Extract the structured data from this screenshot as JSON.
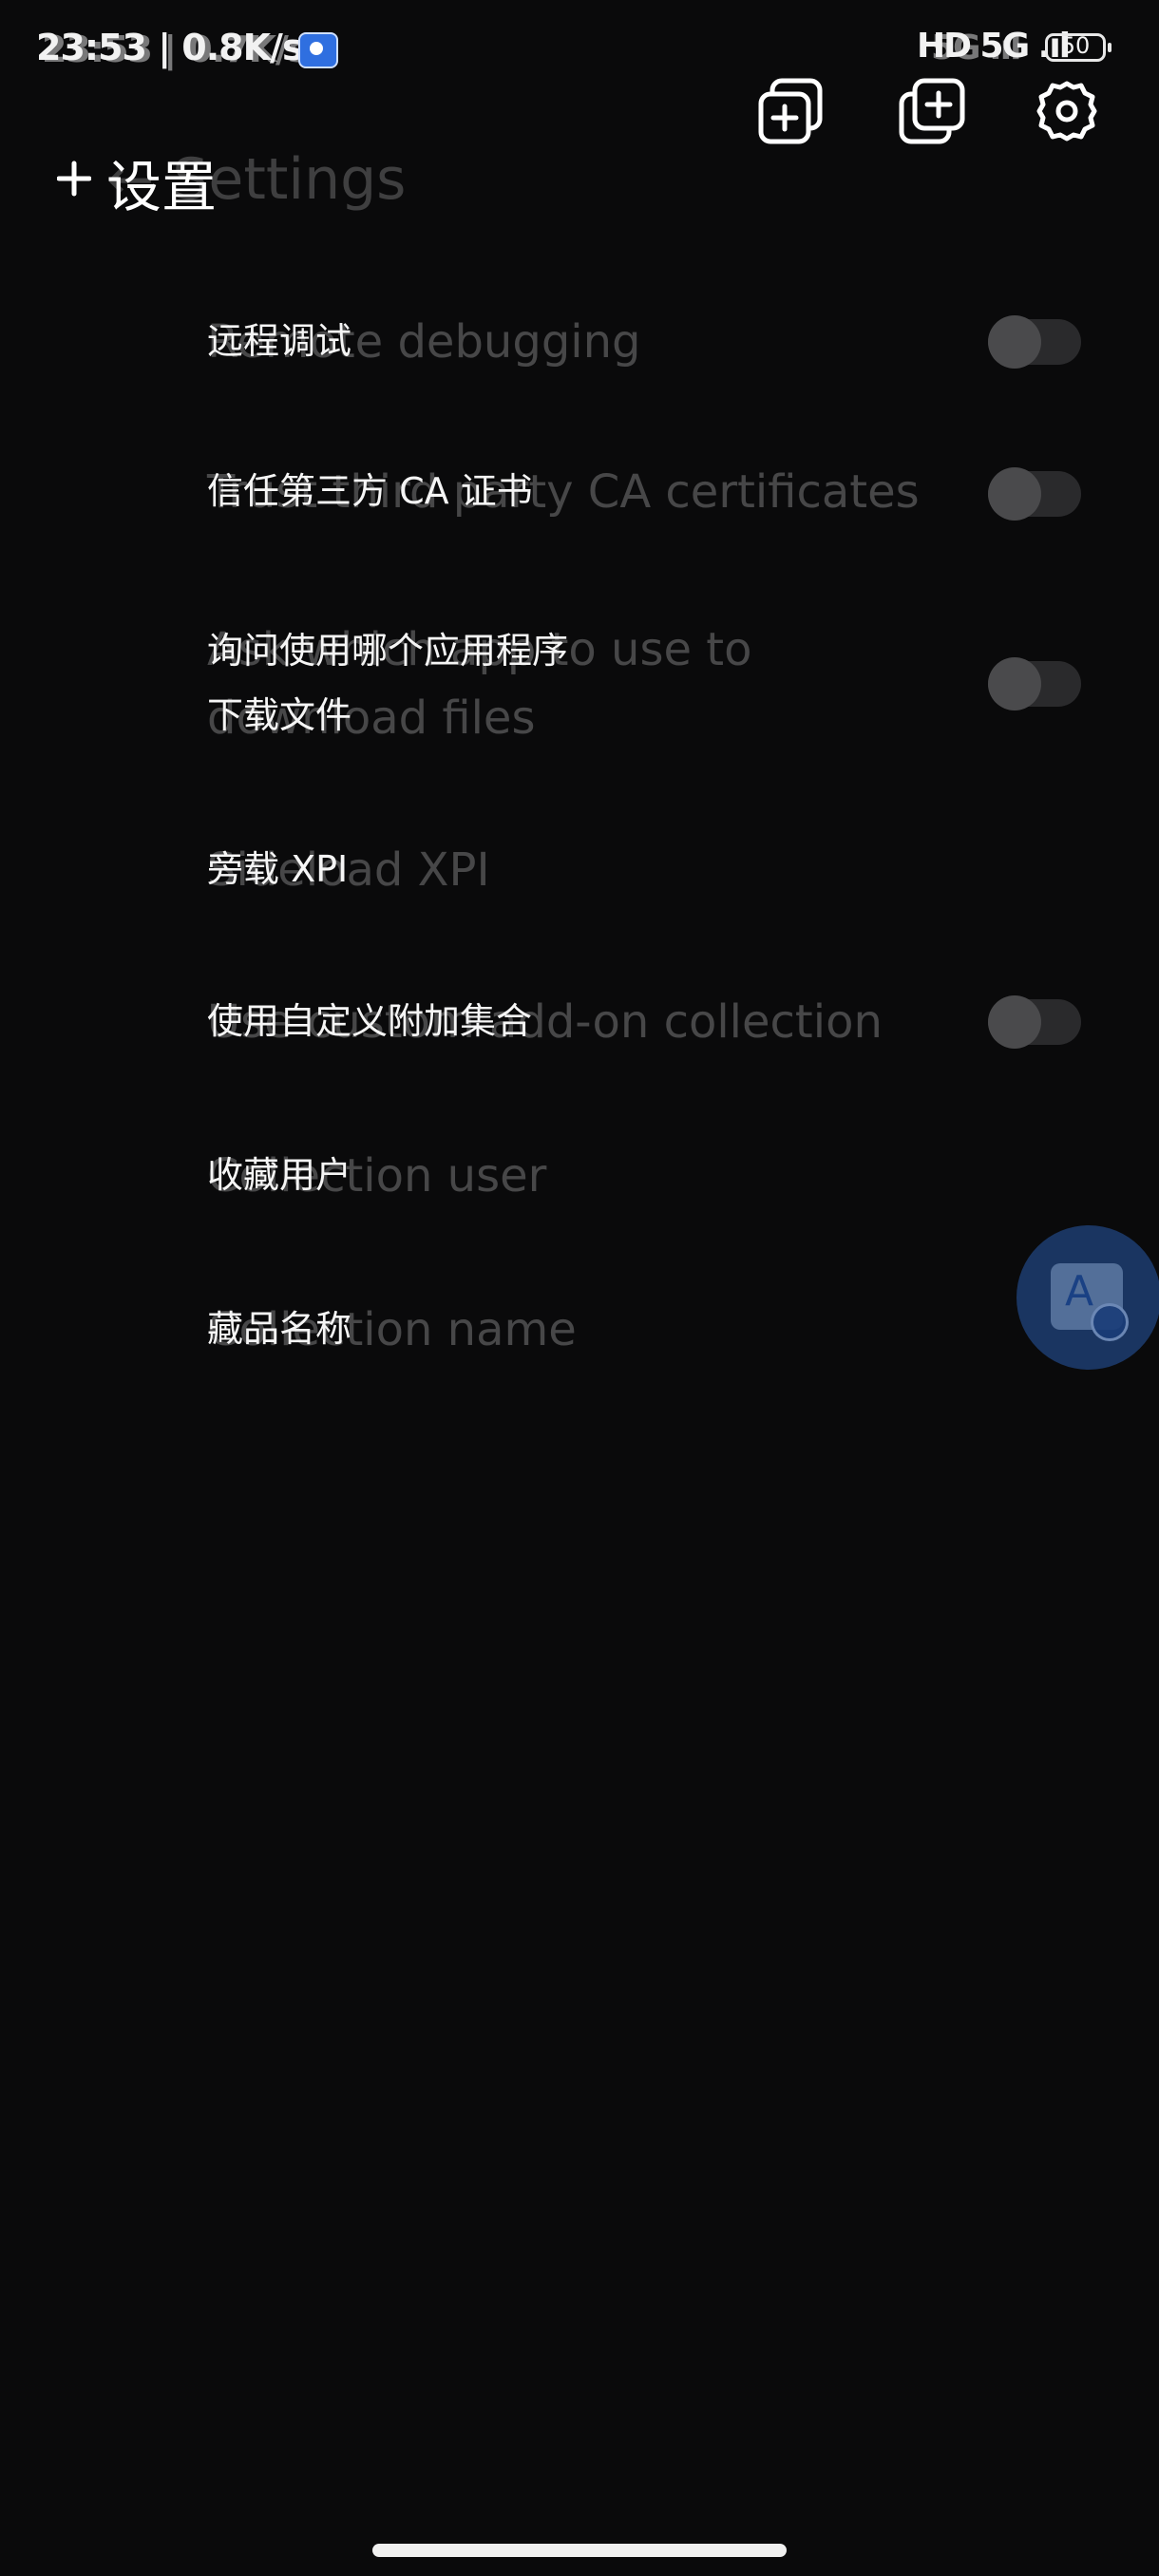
{
  "status_bar": {
    "time_speed": "23:53 | 0.8K/s",
    "ghost_text": "23:53 | 0.7K/s",
    "network_text": "HD 5G .ıl",
    "ghost_network": "5G .ıl",
    "battery": "50"
  },
  "header": {
    "title": "设置",
    "ghost_title": "← Settings"
  },
  "top_icons": [
    "add-tab-icon",
    "new-tab-icon",
    "gear-icon"
  ],
  "settings": [
    {
      "label": "远程调试",
      "ghost": "Remote debugging",
      "toggle": true,
      "on": false
    },
    {
      "label": "信任第三方 CA 证书",
      "ghost": "Trust third party CA certificates",
      "toggle": true,
      "on": false
    },
    {
      "label_lines": [
        "询问使用哪个应用程序",
        "下载文件"
      ],
      "ghost_lines": [
        "Ask which app to use to",
        "download files"
      ],
      "toggle": true,
      "on": false
    },
    {
      "label": "旁载 XPI",
      "ghost": "Sideload XPI",
      "toggle": false
    },
    {
      "label": "使用自定义附加集合",
      "ghost": "Use custom add-on collection",
      "toggle": true,
      "on": false
    },
    {
      "label": "收藏用户",
      "ghost": "Collection user",
      "toggle": false
    },
    {
      "label": "藏品名称",
      "ghost": "Collection name",
      "toggle": false
    }
  ],
  "float_button": {
    "icon": "translate-icon",
    "letter": "A"
  }
}
